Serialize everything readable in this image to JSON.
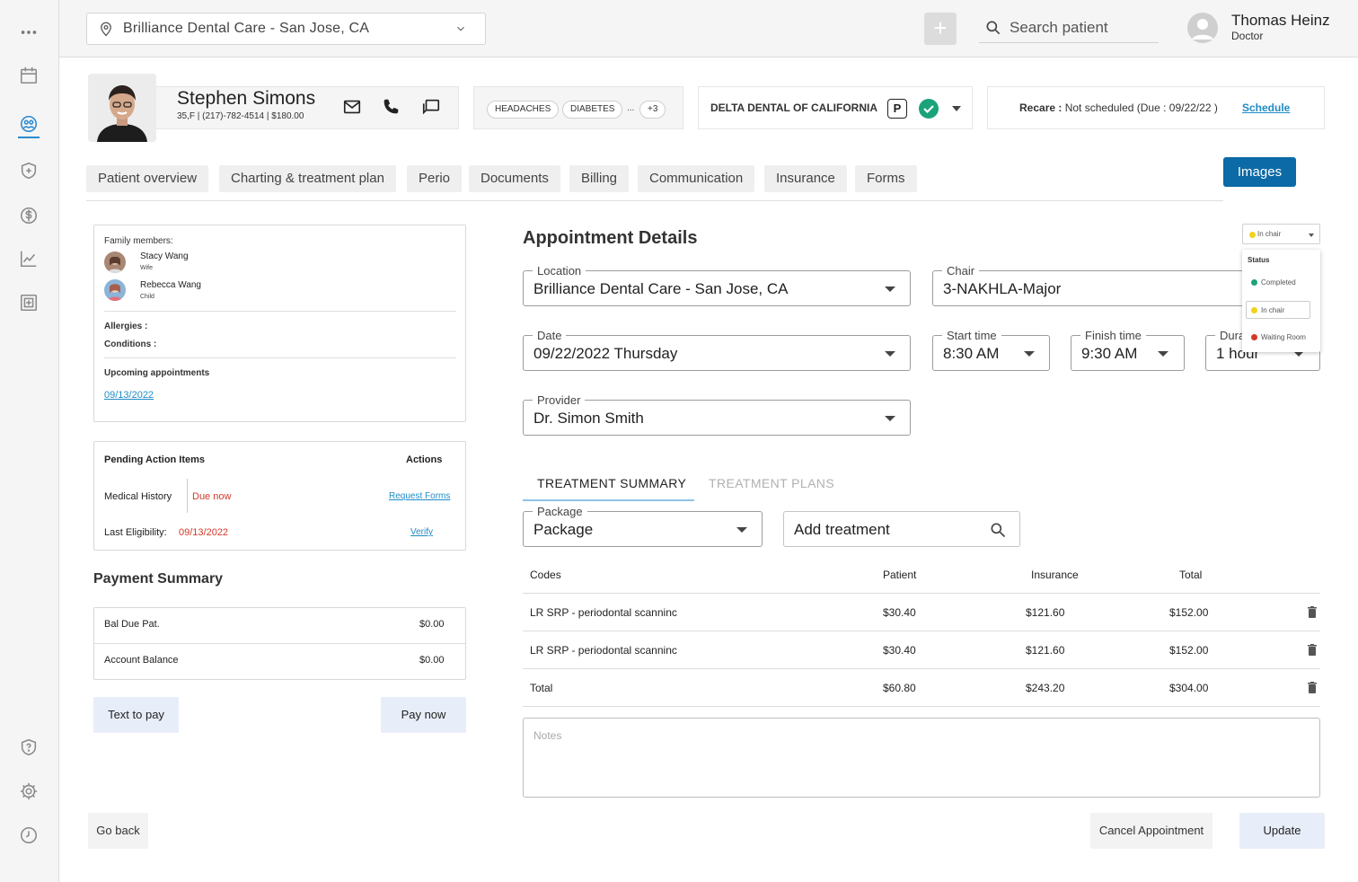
{
  "header": {
    "location": "Brilliance Dental Care - San Jose, CA",
    "search_placeholder": "Search patient",
    "user_name": "Thomas Heinz",
    "user_role": "Doctor",
    "plus_label": "+"
  },
  "patient": {
    "name": "Stephen Simons",
    "sub": "35,F | (217)-782-4514 | $180.00",
    "tags": [
      "HEADACHES",
      "DIABETES"
    ],
    "tags_more": "...",
    "tags_count": "+3",
    "insurance": "DELTA DENTAL OF CALIFORNIA",
    "insurance_badge": "P",
    "recare_label": "Recare :",
    "recare_value": "Not scheduled (Due : 09/22/22 )",
    "schedule_link": "Schedule"
  },
  "tabs": [
    "Patient overview",
    "Charting & treatment plan",
    "Perio",
    "Documents",
    "Billing",
    "Communication",
    "Insurance",
    "Forms"
  ],
  "images_button": "Images",
  "family": {
    "title": "Family members:",
    "members": [
      {
        "name": "Stacy Wang",
        "relation": "Wife"
      },
      {
        "name": "Rebecca Wang",
        "relation": "Child"
      }
    ],
    "allergies_label": "Allergies :",
    "conditions_label": "Conditions :",
    "upcoming_label": "Upcoming appointments",
    "upcoming_date": "09/13/2022"
  },
  "pending": {
    "title": "Pending Action Items",
    "actions_label": "Actions",
    "medical_label": "Medical History",
    "medical_status": "Due now",
    "medical_action": "Request Forms",
    "elig_label": "Last Eligibility:",
    "elig_date": "09/13/2022",
    "elig_action": "Verify"
  },
  "payment": {
    "title": "Payment Summary",
    "rows": [
      {
        "label": "Bal Due Pat.",
        "value": "$0.00"
      },
      {
        "label": "Account Balance",
        "value": "$0.00"
      }
    ],
    "text_to_pay": "Text to pay",
    "pay_now": "Pay now"
  },
  "appointment": {
    "title": "Appointment Details",
    "status_value": "In chair",
    "status_menu": {
      "title": "Status",
      "options": [
        {
          "label": "Completed",
          "color": "#1aa37a"
        },
        {
          "label": "In chair",
          "color": "#f2d21b"
        },
        {
          "label": "Waiting Room",
          "color": "#d23a2a"
        }
      ]
    },
    "location_label": "Location",
    "location_value": "Brilliance Dental Care - San Jose, CA",
    "chair_label": "Chair",
    "chair_value": "3-NAKHLA-Major",
    "date_label": "Date",
    "date_value": "09/22/2022 Thursday",
    "start_label": "Start time",
    "start_value": "8:30 AM",
    "finish_label": "Finish time",
    "finish_value": "9:30 AM",
    "duration_label": "Dura",
    "duration_value": "1 hour",
    "provider_label": "Provider",
    "provider_value": "Dr. Simon Smith"
  },
  "treatment": {
    "tab_active": "TREATMENT SUMMARY",
    "tab_inactive": "TREATMENT PLANS",
    "package_label": "Package",
    "package_value": "Package",
    "add_placeholder": "Add treatment",
    "headers": [
      "Codes",
      "Patient",
      "Insurance",
      "Total"
    ],
    "rows": [
      {
        "code": "LR SRP - periodontal scanninc",
        "patient": "$30.40",
        "insurance": "$121.60",
        "total": "$152.00"
      },
      {
        "code": "LR SRP - periodontal scanninc",
        "patient": "$30.40",
        "insurance": "$121.60",
        "total": "$152.00"
      },
      {
        "code": "Total",
        "patient": "$60.80",
        "insurance": "$243.20",
        "total": "$304.00"
      }
    ],
    "notes_placeholder": "Notes"
  },
  "footer": {
    "go_back": "Go back",
    "cancel": "Cancel Appointment",
    "update": "Update"
  },
  "colors": {
    "accent": "#0c6aa6",
    "link": "#1f8cc6",
    "danger": "#d23a2a",
    "success": "#1aa37a"
  }
}
